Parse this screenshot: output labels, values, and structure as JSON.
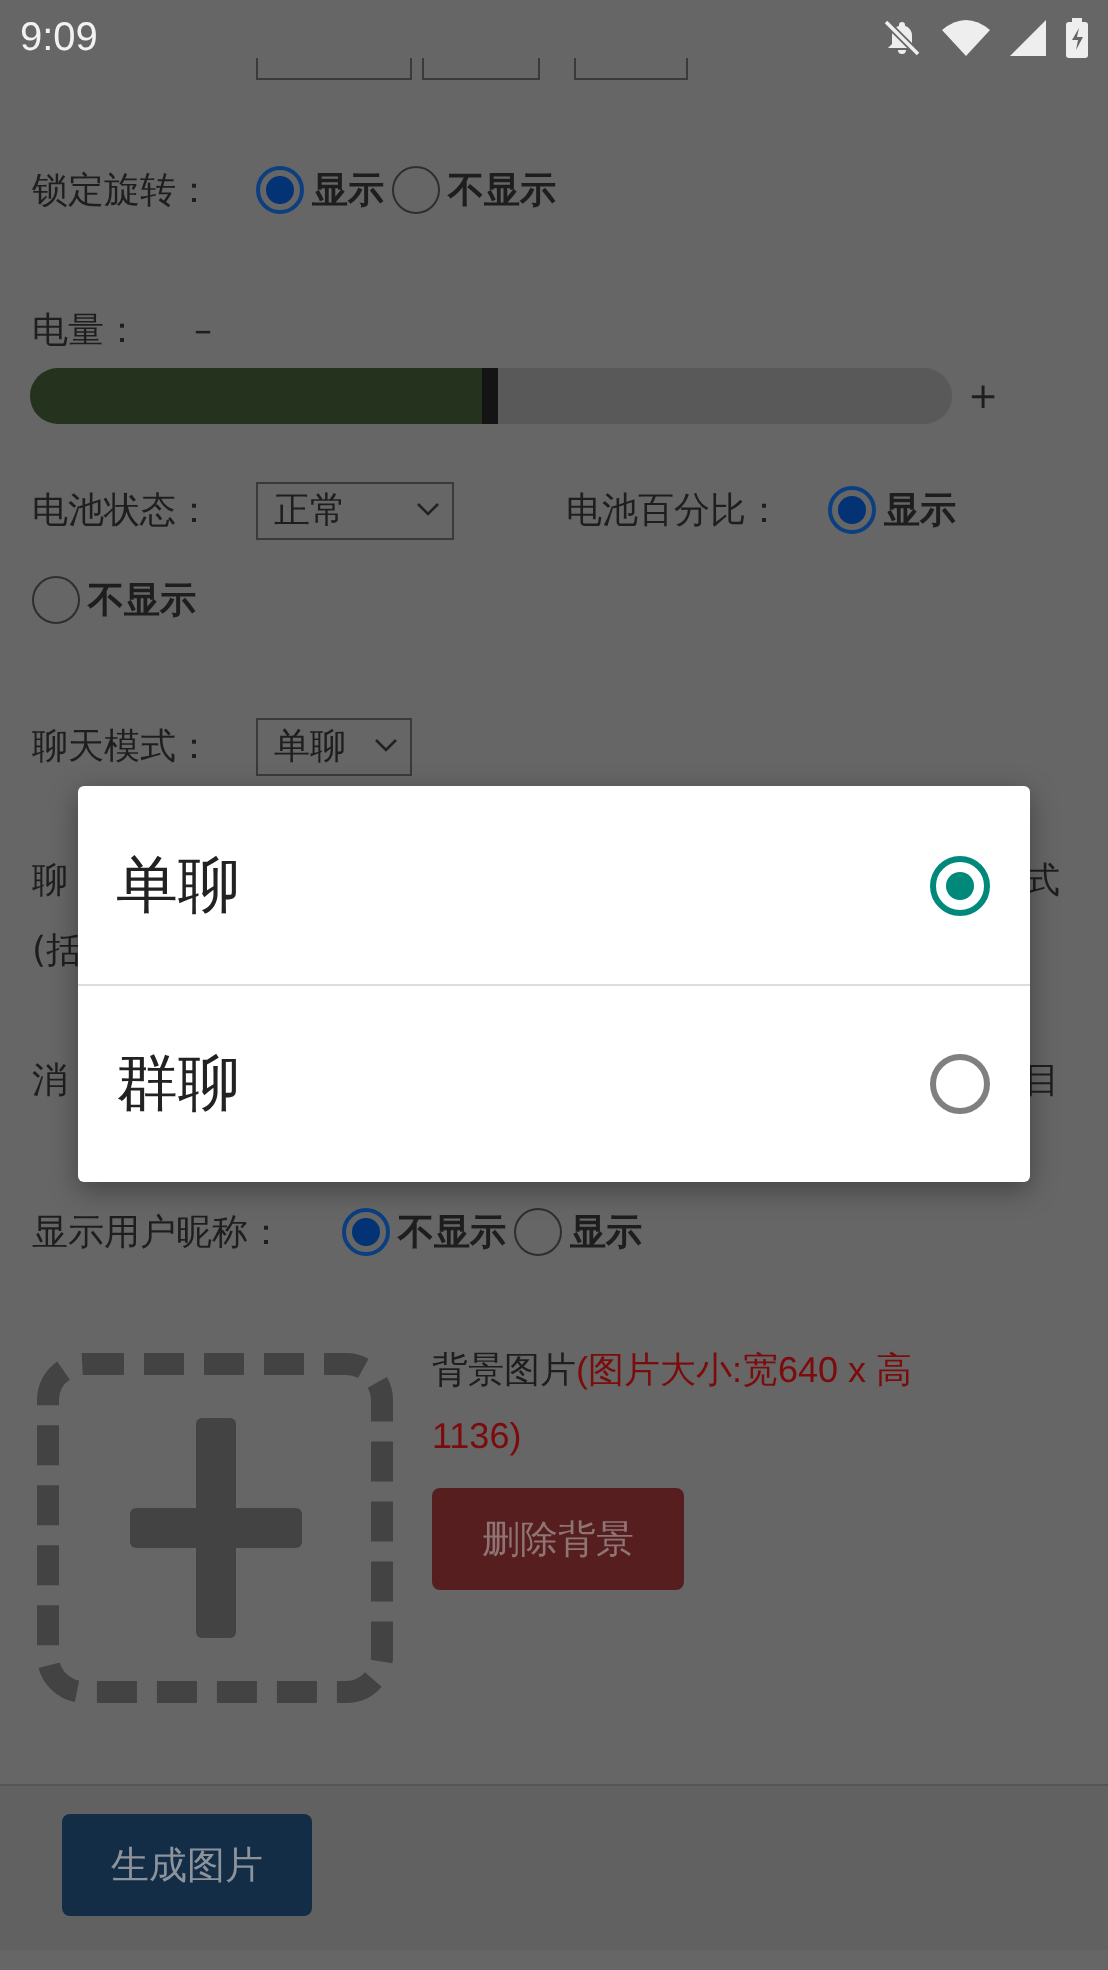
{
  "status_bar": {
    "time": "9:09"
  },
  "lock_rotation": {
    "label": "锁定旋转：",
    "options": [
      {
        "label": "显示",
        "selected": true
      },
      {
        "label": "不显示",
        "selected": false
      }
    ]
  },
  "battery_level": {
    "label": "电量：",
    "minus": "–",
    "plus": "+",
    "level": 0.49
  },
  "battery_status": {
    "label": "电池状态：",
    "value": "正常"
  },
  "battery_percent": {
    "label": "电池百分比：",
    "options": [
      {
        "label": "显示",
        "selected": true
      },
      {
        "label": "不显示",
        "selected": false
      }
    ]
  },
  "chat_mode": {
    "label": "聊天模式：",
    "value": "单聊"
  },
  "covered_rows": [
    {
      "left": "聊",
      "right": "式"
    },
    {
      "left": "(括"
    },
    {
      "left": "消",
      "right": "目"
    }
  ],
  "show_nickname": {
    "label": "显示用户昵称：",
    "options": [
      {
        "label": "不显示",
        "selected": true
      },
      {
        "label": "显示",
        "selected": false
      }
    ]
  },
  "background": {
    "label": "背景图片",
    "hint": "(图片大小:宽640 x 高 1136)",
    "delete_button": "删除背景"
  },
  "generate_button": "生成图片",
  "dialog": {
    "options": [
      {
        "label": "单聊",
        "selected": true
      },
      {
        "label": "群聊",
        "selected": false
      }
    ]
  }
}
